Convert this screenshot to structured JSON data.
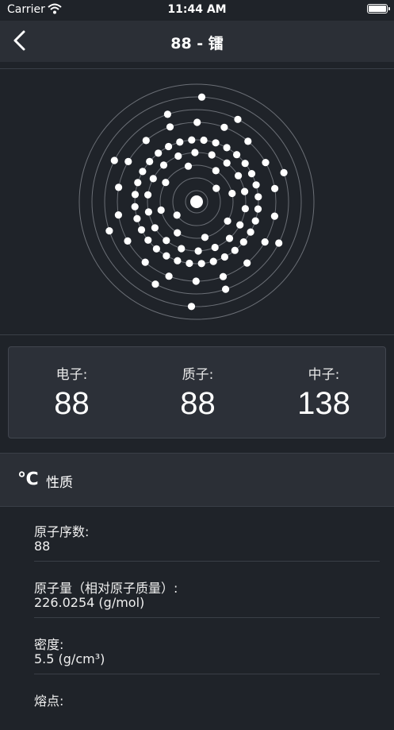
{
  "status_bar": {
    "carrier": "Carrier",
    "time": "11:44 AM"
  },
  "nav": {
    "title": "88 - 镭"
  },
  "counts": [
    {
      "label": "电子:",
      "value": "88"
    },
    {
      "label": "质子:",
      "value": "88"
    },
    {
      "label": "中子:",
      "value": "138"
    }
  ],
  "section": {
    "icon": "℃",
    "title": "性质"
  },
  "properties": [
    {
      "key": "原子序数:",
      "value": "88"
    },
    {
      "key": "原子量（相对原子质量）:",
      "value": "226.0254 (g/mol)"
    },
    {
      "key": "密度:",
      "value": "5.5 (g/cm³)"
    },
    {
      "key": "熔点:",
      "value": ""
    }
  ],
  "atom": {
    "electron_shells": [
      2,
      8,
      18,
      32,
      18,
      8,
      2
    ]
  }
}
